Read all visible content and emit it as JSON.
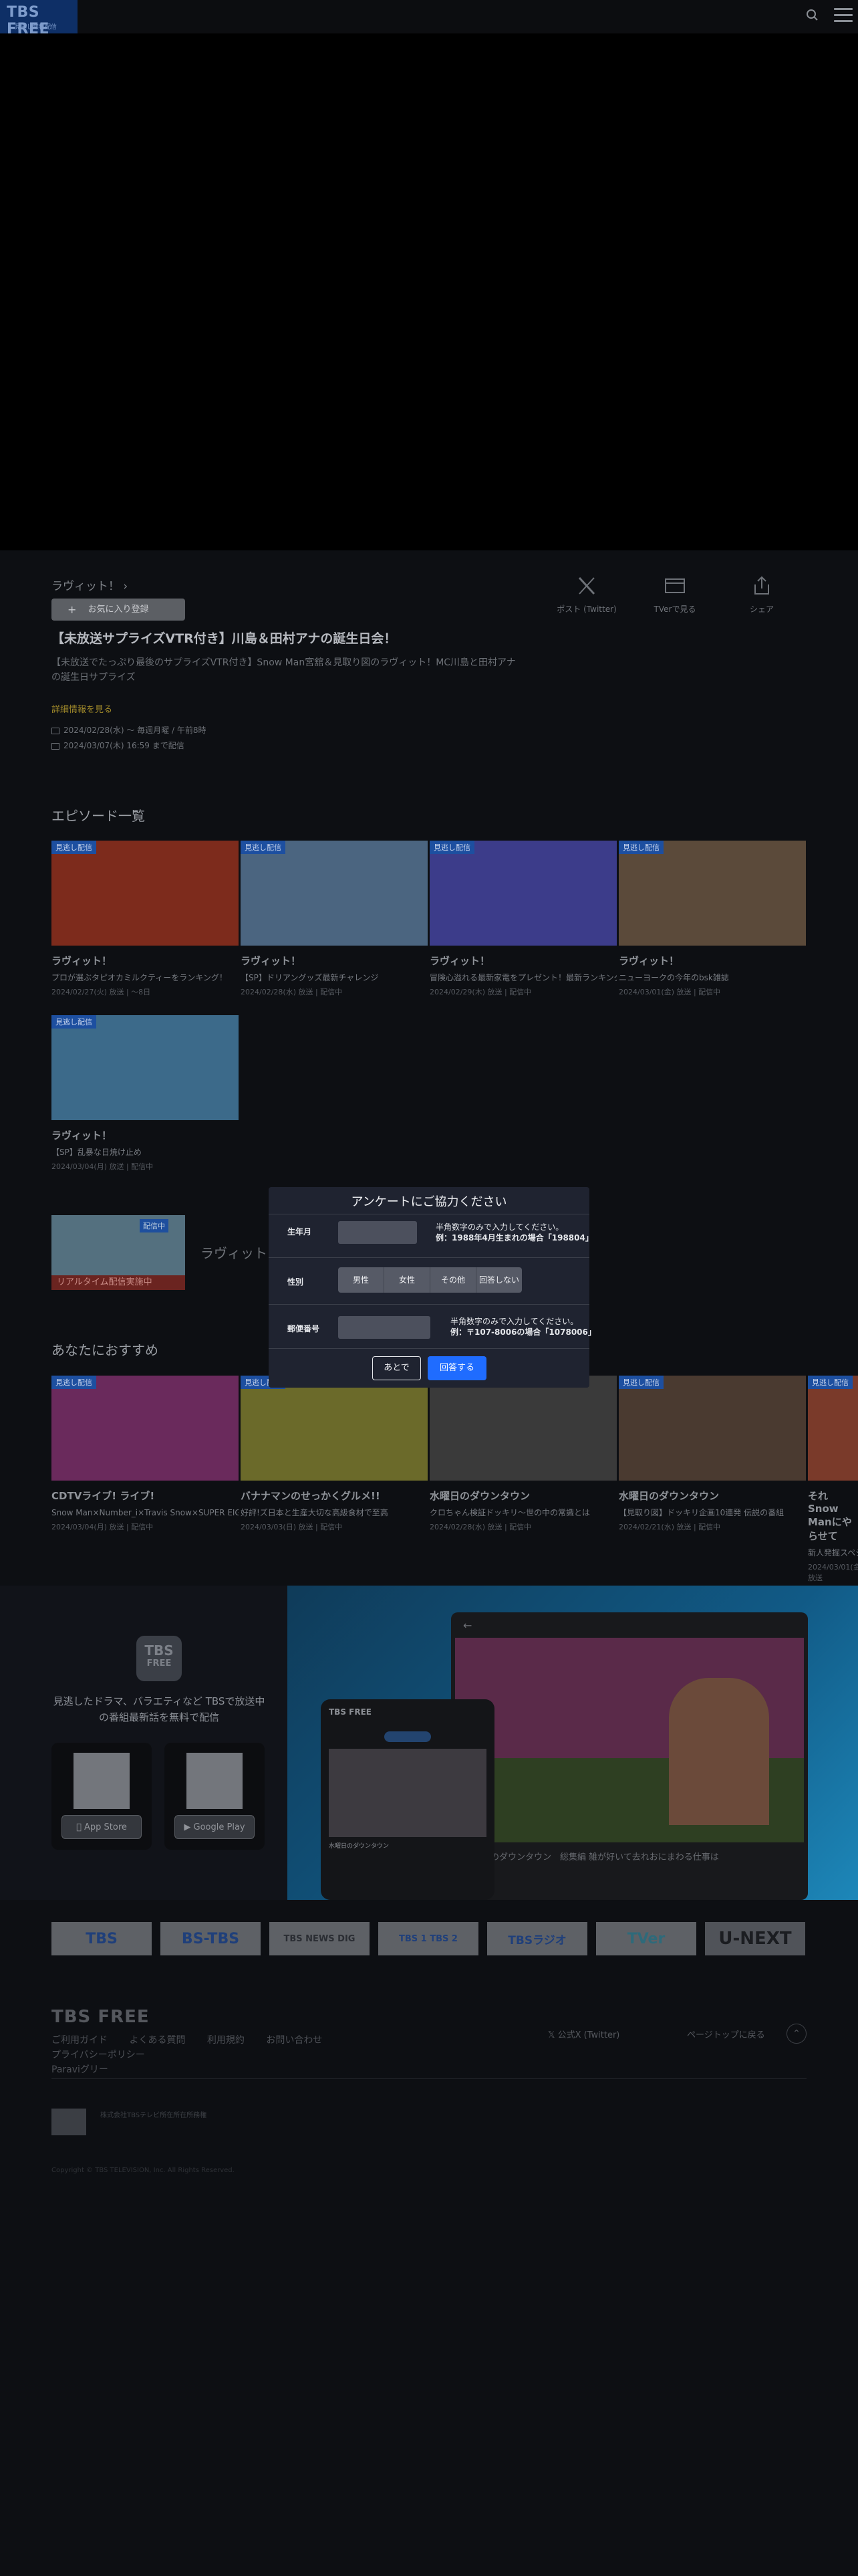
{
  "header": {
    "logo_main": "TBS FREE",
    "logo_sub": "見逃し無料配信"
  },
  "episode": {
    "series": "ラヴィット！",
    "chevron": "›",
    "favorite_label": "お気に入り登録",
    "title": "【未放送サプライズVTR付き】川島＆田村アナの誕生日会！",
    "description": "【未放送でたっぷり最後のサプライズVTR付き】Snow Man宮舘＆見取り図のラヴィット！MC川島と田村アナの誕生日サプライズ",
    "more_link": "詳細情報を見る",
    "broadcast": "2024/02/28(水)  ～ 毎週月曜 / 午前8時",
    "available": "2024/03/07(木)  16:59 まで配信"
  },
  "share": [
    {
      "icon": "x-logo-icon",
      "label": "ポスト (Twitter)"
    },
    {
      "icon": "tver-icon",
      "label": "TVerで見る"
    },
    {
      "icon": "share-icon",
      "label": "シェア"
    }
  ],
  "episodes_section": {
    "title": "エピソード一覧",
    "items": [
      {
        "badge": "見逃し配信",
        "title": "ラヴィット！",
        "sub": "プロが選ぶタピオカミルクティーをランキング！",
        "date": "2024/02/27(火)  放送 | ～8日",
        "thumb": "#7d2b1c"
      },
      {
        "badge": "見逃し配信",
        "title": "ラヴィット！",
        "sub": "【SP】ドリアングッズ最新チャレンジ",
        "date": "2024/02/28(水)  放送 | 配信中",
        "thumb": "#4b6580"
      },
      {
        "badge": "見逃し配信",
        "title": "ラヴィット！",
        "sub": "冒険心溢れる最新家電をプレゼント！最新ランキング",
        "date": "2024/02/29(木)  放送 | 配信中",
        "thumb": "#3c3c8a"
      },
      {
        "badge": "見逃し配信",
        "title": "ラヴィット！",
        "sub": "ニューヨークの今年のbsk雑誌",
        "date": "2024/03/01(金)  放送 | 配信中",
        "thumb": "#5b4a3a"
      },
      {
        "badge": "見逃し配信",
        "title": "ラヴィット！",
        "sub": "【SP】乱暴な日焼け止め",
        "date": "2024/03/04(月)  放送 | 配信中",
        "thumb": "#3c6a8a"
      }
    ]
  },
  "live": {
    "badge": "配信中",
    "label": "リアルタイム配信実施中",
    "name": "ラヴィット！"
  },
  "recommend_section": {
    "title": "あなたにおすすめ",
    "items": [
      {
        "badge": "見逃し配信",
        "title": "CDTVライブ! ライブ!",
        "sub": "Snow Man×Number_i×Travis Snow×SUPER EIGHT×なにわ男子",
        "date": "2024/03/04(月)  放送 | 配信中",
        "thumb": "#6a2a5c"
      },
      {
        "badge": "見逃し配信",
        "title": "バナナマンのせっかくグルメ!!",
        "sub": "好評!ズ日本と生産大切な高級食材で至高",
        "date": "2024/03/03(日)  放送 | 配信中",
        "thumb": "#6b6a2a"
      },
      {
        "badge": "",
        "title": "水曜日のダウンタウン",
        "sub": "クロちゃん検証ドッキリ〜世の中の常識とは",
        "date": "2024/02/28(水)  放送 | 配信中",
        "thumb": "#3a3a3a"
      },
      {
        "badge": "見逃し配信",
        "title": "水曜日のダウンタウン",
        "sub": "【見取り図】ドッキリ企画10連発 伝説の番組",
        "date": "2024/02/21(水)  放送 | 配信中",
        "thumb": "#4a3a30"
      },
      {
        "badge": "見逃し配信",
        "title": "それSnow Manにやらせて",
        "sub": "新人発掘スペシャル",
        "date": "2024/03/01(金)  放送",
        "thumb": "#7a3a2a"
      }
    ]
  },
  "survey": {
    "title": "アンケートにご協力ください",
    "birth_label": "生年月",
    "birth_hint_1": "半角数字のみで入力してください。",
    "birth_hint_2": "例：1988年4月生まれの場合「198804」",
    "gender_label": "性別",
    "gender_options": [
      "男性",
      "女性",
      "その他",
      "回答しない"
    ],
    "zip_label": "郵便番号",
    "zip_hint_1": "半角数字のみで入力してください。",
    "zip_hint_2": "例：〒107-8006の場合「1078006」",
    "later": "あとで",
    "submit": "回答する"
  },
  "promo": {
    "logo_1": "TBS",
    "logo_2": "FREE",
    "text": "見逃したドラマ、バラエティなど TBSで放送中の番組最新話を無料で配信",
    "app_store": "App Store",
    "google_play": "Google Play",
    "tv_caption": "水曜日のダウンタウン　総集編 雑が好いて去れおにまわる仕事は",
    "phone_logo": "TBS FREE",
    "phone_caption": "水曜日のダウンタウン"
  },
  "channels": [
    "TBS",
    "BS-TBS",
    "TBS NEWS DIG",
    "TBS 1 TBS 2",
    "TBSラジオ",
    "TVer",
    "U-NEXT"
  ],
  "footer": {
    "logo": "TBS FREE",
    "links": [
      "ご利用ガイド",
      "よくある質問",
      "利用規約",
      "お問い合わせ",
      "プライバシーポリシー",
      "Paraviグリー"
    ],
    "x_label": "公式X (Twitter)",
    "pagetop": "ページトップに戻る",
    "badge_text": "株式会社TBSテレビ所在所在所務権",
    "copyright": "Copyright © TBS TELEVISION, Inc. All Rights Reserved."
  }
}
